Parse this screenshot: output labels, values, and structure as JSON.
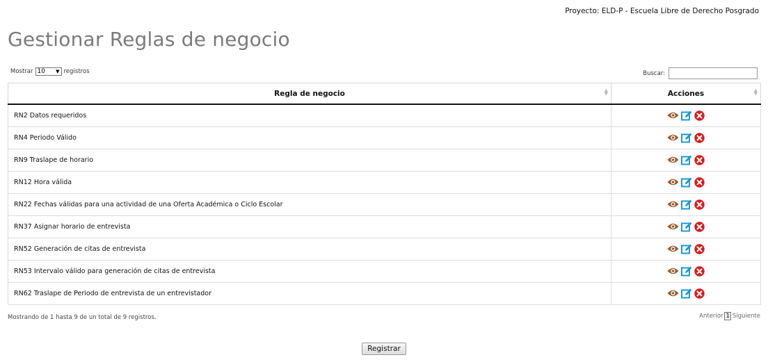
{
  "header": {
    "project": "Proyecto: ELD-P - Escuela Libre de Derecho Posgrado",
    "title": "Gestionar Reglas de negocio"
  },
  "controls": {
    "show_label": "Mostrar",
    "show_value": "10",
    "records_label": "registros",
    "search_label": "Buscar:",
    "search_value": ""
  },
  "table": {
    "columns": [
      "Regla de negocio",
      "Acciones"
    ],
    "rows": [
      "RN2 Datos requeridos",
      "RN4 Periodo Válido",
      "RN9 Traslape de horario",
      "RN12 Hora válida",
      "RN22 Fechas válidas para una actividad de una Oferta Académica o Ciclo Escolar",
      "RN37 Asignar horario de entrevista",
      "RN52 Generación de citas de entrevista",
      "RN53 Intervalo válido para generación de citas de entrevista",
      "RN62 Traslape de Periodo de entrevista de un entrevistador"
    ],
    "action_icons": [
      "eye-icon",
      "edit-icon",
      "delete-icon"
    ]
  },
  "footer": {
    "info": "Mostrando de 1 hasta 9 de un total de 9 registros.",
    "prev": "Anterior",
    "page": "1",
    "next": "Siguiente",
    "register": "Registrar"
  },
  "colors": {
    "title": "#7a7a7a",
    "eye": "#9a5b2e",
    "edit": "#1a9ad6",
    "delete": "#e01818"
  }
}
